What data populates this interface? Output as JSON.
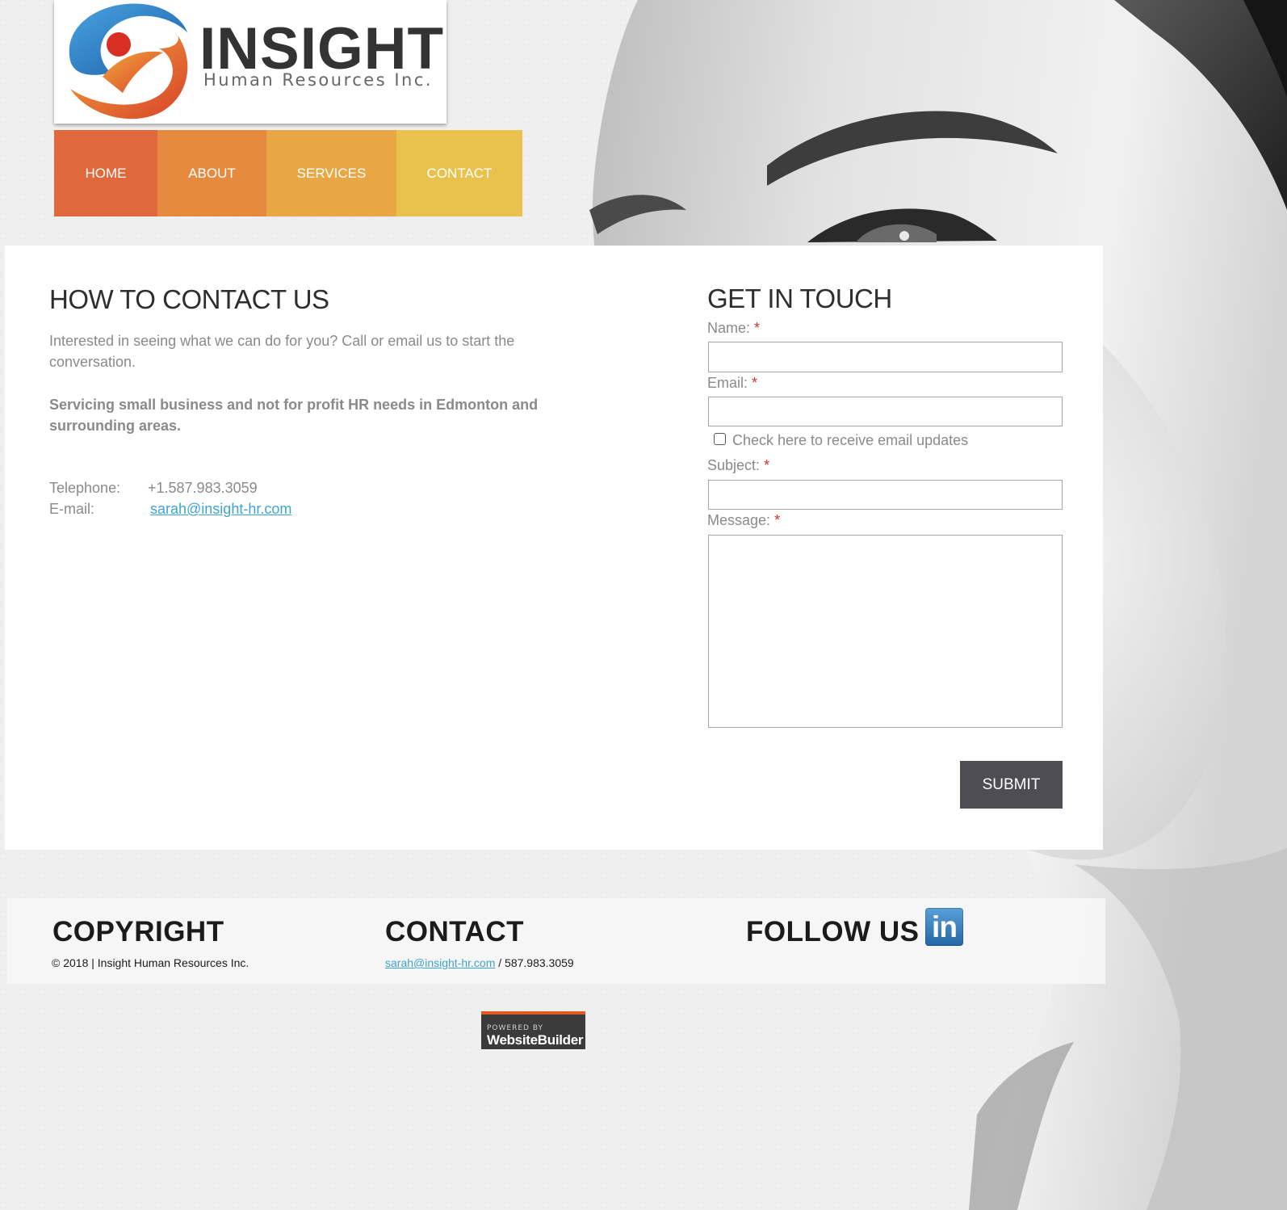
{
  "colors": {
    "nav_home": "#e1683a",
    "nav_about": "#e58a3f",
    "nav_services": "#e8a744",
    "nav_contact": "#e8c24d",
    "link": "#3fa4cc",
    "required": "#d0312d",
    "submit_bg": "#4d4d53",
    "heading": "#2e2e2e",
    "body_text": "#8a8a8a"
  },
  "logo": {
    "name": "INSIGHT",
    "tagline": "Human Resources Inc."
  },
  "nav": {
    "items": [
      {
        "label": "HOME"
      },
      {
        "label": "ABOUT"
      },
      {
        "label": "SERVICES"
      },
      {
        "label": "CONTACT"
      }
    ]
  },
  "contact_section": {
    "title": "HOW TO CONTACT US",
    "intro": "Interested in seeing what we can do for you? Call or email us to start the conversation.",
    "service_area": "Servicing small business and not for profit HR needs in Edmonton and surrounding areas.",
    "telephone_label": "Telephone:",
    "telephone_value": "+1.587.983.3059",
    "email_label": "E-mail:",
    "email_value": "sarah@insight-hr.com"
  },
  "form": {
    "title": "GET IN TOUCH",
    "name_label": "Name:",
    "email_label": "Email:",
    "updates_label": "Check here to receive email updates",
    "updates_checked": false,
    "subject_label": "Subject:",
    "message_label": "Message:",
    "required_marker": "*",
    "name_value": "",
    "email_value": "",
    "subject_value": "",
    "message_value": "",
    "submit_label": "SUBMIT"
  },
  "footer": {
    "copyright_title": "COPYRIGHT",
    "copyright_text": "© 2018 | Insight Human Resources Inc.",
    "contact_title": "CONTACT",
    "contact_email": "sarah@insight-hr.com",
    "contact_separator": " / 587.983.3059",
    "follow_title": "FOLLOW US",
    "linkedin_icon_text": "in"
  },
  "powered_by": {
    "line1": "POWERED BY",
    "line2": "WebsiteBuilder"
  }
}
